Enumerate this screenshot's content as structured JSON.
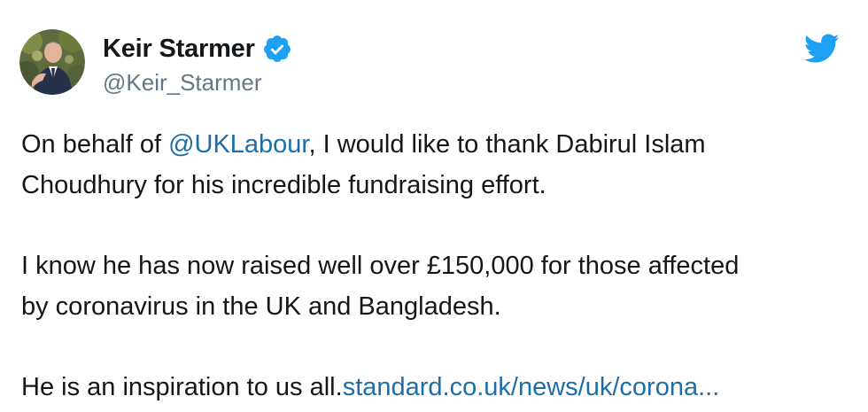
{
  "tweet": {
    "display_name": "Keir Starmer",
    "handle": "@Keir_Starmer",
    "verified": true,
    "avatar_icon": "user-avatar-photo",
    "logo_icon": "twitter-bird-icon",
    "para1": {
      "before": "On behalf of ",
      "mention": "@UKLabour",
      "after_line1": ", I would like to thank Dabirul Islam",
      "line2": "Choudhury for his incredible fundraising effort."
    },
    "para2": {
      "line1": "I know he has now raised well over £150,000 for those affected",
      "line2": "by coronavirus in the UK and Bangladesh."
    },
    "para3": {
      "text": "He is an inspiration to us all.",
      "link": "standard.co.uk/news/uk/corona..."
    }
  },
  "colors": {
    "text": "#14171a",
    "secondary": "#657786",
    "link": "#1b6fa8",
    "brand": "#1da1f2"
  }
}
